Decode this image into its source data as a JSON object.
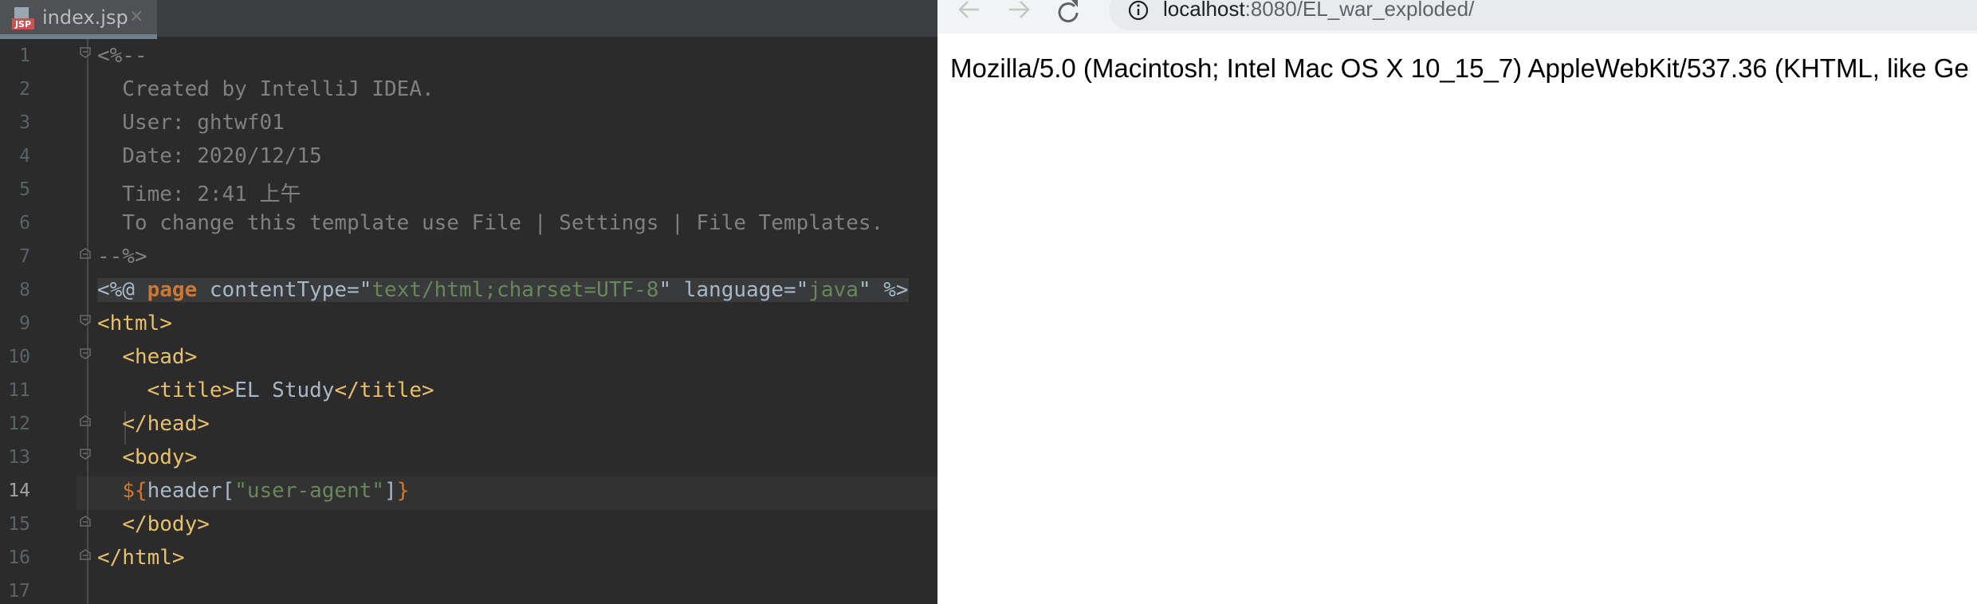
{
  "editor_tab": {
    "icon_text": "JSP",
    "filename": "index.jsp",
    "close": "×"
  },
  "editor": {
    "current_line": 14,
    "lines": [
      {
        "num": "1",
        "text": "<%--"
      },
      {
        "num": "2",
        "text": "  Created by IntelliJ IDEA."
      },
      {
        "num": "3",
        "text": "  User: ghtwf01"
      },
      {
        "num": "4",
        "text": "  Date: 2020/12/15"
      },
      {
        "num": "5",
        "text": "  Time: 2:41 上午"
      },
      {
        "num": "6",
        "text": "  To change this template use File | Settings | File Templates."
      },
      {
        "num": "7",
        "text": "--%>"
      },
      {
        "num": "8",
        "parts": [
          "<%@ ",
          "page",
          " contentType=\"",
          "text/html;charset=UTF-8",
          "\" language=\"",
          "java",
          "\" %>"
        ]
      },
      {
        "num": "9",
        "parts": [
          "<html>"
        ]
      },
      {
        "num": "10",
        "parts": [
          "  ",
          "<head>"
        ]
      },
      {
        "num": "11",
        "parts": [
          "    ",
          "<title>",
          "EL Study",
          "</title>"
        ]
      },
      {
        "num": "12",
        "parts": [
          "  ",
          "</head>"
        ]
      },
      {
        "num": "13",
        "parts": [
          "  ",
          "<body>"
        ]
      },
      {
        "num": "14",
        "parts": [
          "  ",
          "${",
          "header[",
          "\"user-agent\"",
          "]",
          "}"
        ]
      },
      {
        "num": "15",
        "parts": [
          "  ",
          "</body>"
        ]
      },
      {
        "num": "16",
        "parts": [
          "</html>"
        ]
      },
      {
        "num": "17",
        "parts": [
          ""
        ]
      }
    ]
  },
  "browser": {
    "url_host": "localhost",
    "url_rest": ":8080/EL_war_exploded/",
    "page_text": "Mozilla/5.0 (Macintosh; Intel Mac OS X 10_15_7) AppleWebKit/537.36 (KHTML, like Ge",
    "icons": [
      "back-arrow-icon",
      "forward-arrow-icon",
      "reload-icon",
      "info-icon"
    ]
  },
  "colors": {
    "editor_bg": "#2b2b2b",
    "comment": "#808080",
    "tag": "#e8bf6a",
    "keyword": "#cc7832",
    "string": "#6a8759",
    "text": "#a9b7c6"
  }
}
